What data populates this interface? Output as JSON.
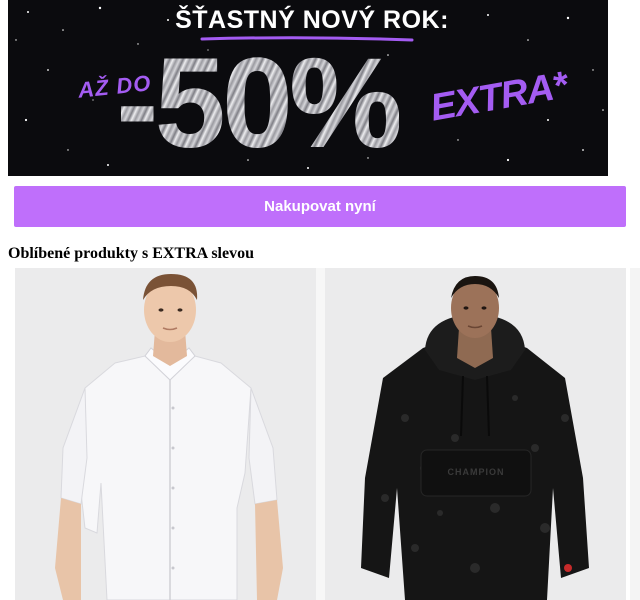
{
  "banner": {
    "headline": "ŠŤASTNÝ NOVÝ ROK:",
    "prefix": "AŽ DO",
    "discount": "-50%",
    "suffix": "EXTRA*",
    "accent_color": "#a45cf2",
    "background_color": "#0b0b0e"
  },
  "cta": {
    "label": "Nakupovat nyní",
    "color": "#bf6ffb"
  },
  "section": {
    "title": "Oblíbené produkty s EXTRA slevou"
  },
  "products": [
    {
      "image": "man-white-short-sleeve-shirt"
    },
    {
      "image": "man-black-fleece-hoodie",
      "logo_text": "CHAMPION"
    }
  ]
}
